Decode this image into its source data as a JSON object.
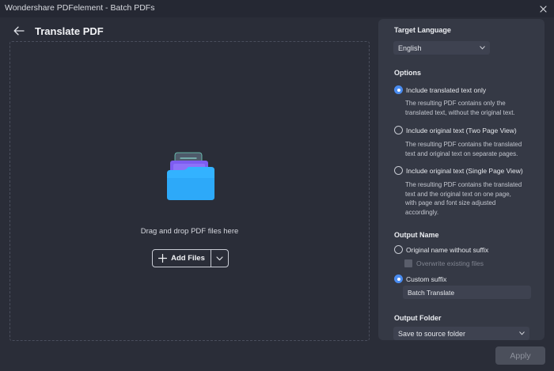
{
  "window": {
    "title": "Wondershare PDFelement - Batch PDFs"
  },
  "header": {
    "title": "Translate PDF"
  },
  "dropzone": {
    "text": "Drag and drop PDF files here",
    "add_files_label": "Add Files"
  },
  "panel": {
    "target_language": {
      "title": "Target Language",
      "selected": "English"
    },
    "options": {
      "title": "Options",
      "items": [
        {
          "label": "Include translated text only",
          "checked": true,
          "desc1": "The resulting PDF contains only the",
          "desc2": "translated text, without the original text."
        },
        {
          "label": "Include original text (Two Page View)",
          "checked": false,
          "desc1": "The resulting PDF contains the translated",
          "desc2": "text and original text on separate pages."
        },
        {
          "label": "Include original text (Single Page View)",
          "checked": false,
          "desc1": "The resulting PDF contains the translated",
          "desc2": "text and the original text on one page,",
          "desc3": "with page and font size adjusted",
          "desc4": "accordingly."
        }
      ]
    },
    "output_name": {
      "title": "Output Name",
      "original_label": "Original name without suffix",
      "overwrite_label": "Overwrite existing files",
      "custom_label": "Custom suffix",
      "suffix_value": "Batch Translate"
    },
    "output_folder": {
      "title": "Output Folder",
      "selected": "Save to source folder"
    }
  },
  "footer": {
    "apply_label": "Apply"
  },
  "colors": {
    "background": "#2a2d38",
    "panel": "#353945",
    "accent": "#4a8cf0",
    "folder_front": "#33b2ff",
    "folder_back": "#7d5cf0"
  }
}
